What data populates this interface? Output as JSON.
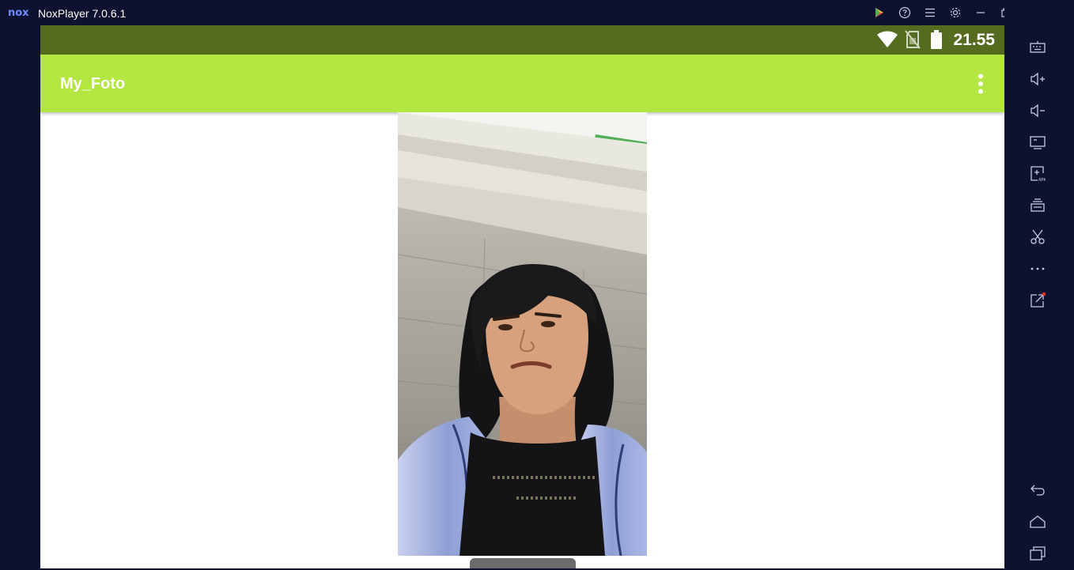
{
  "window": {
    "logo": "nox",
    "title": "NoxPlayer 7.0.6.1"
  },
  "titlebar_icons": [
    "play-store-icon",
    "help-icon",
    "menu-icon",
    "settings-icon",
    "minimize-icon",
    "restore-icon",
    "close-icon",
    "fullscreen-icon"
  ],
  "sidebar_icons": [
    "keyboard-icon",
    "volume-up-icon",
    "volume-down-icon",
    "screen-icon",
    "add-apk-icon",
    "multi-instance-icon",
    "screenshot-icon",
    "more-icon",
    "export-icon",
    "back-icon",
    "home-icon",
    "recents-icon"
  ],
  "status": {
    "time": "21.55"
  },
  "app": {
    "title": "My_Foto"
  },
  "colors": {
    "appbar": "#b3e640",
    "statusbar": "#556b1f",
    "frame": "#0e1230"
  }
}
